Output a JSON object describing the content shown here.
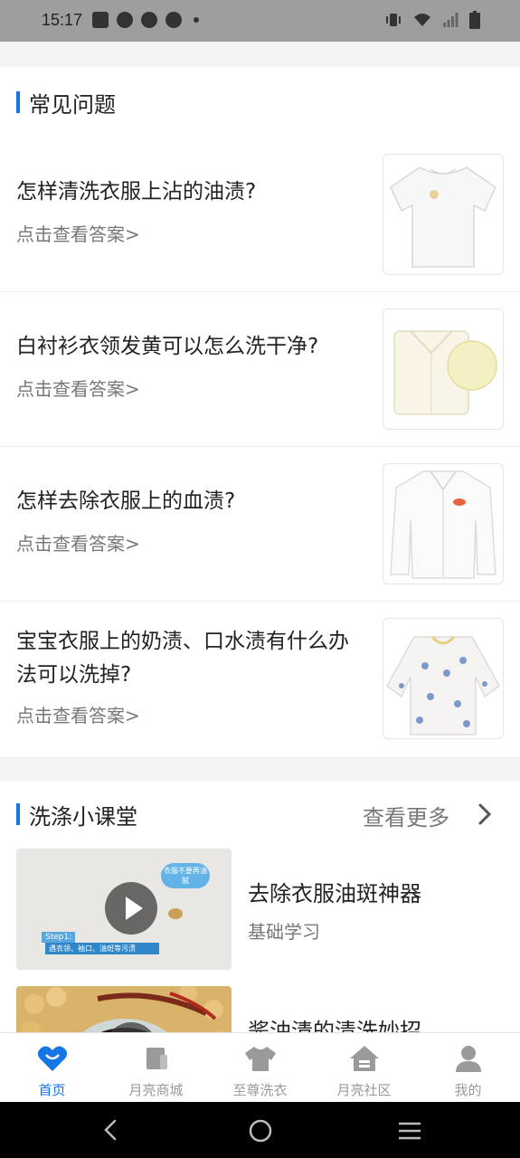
{
  "status_bar": {
    "time": "15:17"
  },
  "faq": {
    "title": "常见问题",
    "items": [
      {
        "question": "怎样清洗衣服上沾的油渍?",
        "link": "点击查看答案>"
      },
      {
        "question": "白衬衫衣领发黄可以怎么洗干净?",
        "link": "点击查看答案>"
      },
      {
        "question": "怎样去除衣服上的血渍?",
        "link": "点击查看答案>"
      },
      {
        "question": "宝宝衣服上的奶渍、口水渍有什么办法可以洗掉?",
        "link": "点击查看答案>"
      }
    ]
  },
  "courses": {
    "title": "洗涤小课堂",
    "more": "查看更多",
    "items": [
      {
        "title": "去除衣服油斑神器",
        "subtitle": "基础学习",
        "thumb_badge": "衣服不要再油腻",
        "thumb_step": "Step1:",
        "thumb_caption": "遇衣领、袖口、油斑等污渍"
      },
      {
        "title": "酱油渍的清洗妙招",
        "subtitle": ""
      }
    ]
  },
  "tabs": [
    {
      "label": "首页",
      "icon": "home-heart-icon",
      "active": true
    },
    {
      "label": "月亮商城",
      "icon": "mall-icon",
      "active": false
    },
    {
      "label": "至尊洗衣",
      "icon": "shirt-icon",
      "active": false
    },
    {
      "label": "月亮社区",
      "icon": "community-house-icon",
      "active": false
    },
    {
      "label": "我的",
      "icon": "user-icon",
      "active": false
    }
  ],
  "colors": {
    "accent": "#1476e6",
    "inactive": "#9a9a9a"
  }
}
